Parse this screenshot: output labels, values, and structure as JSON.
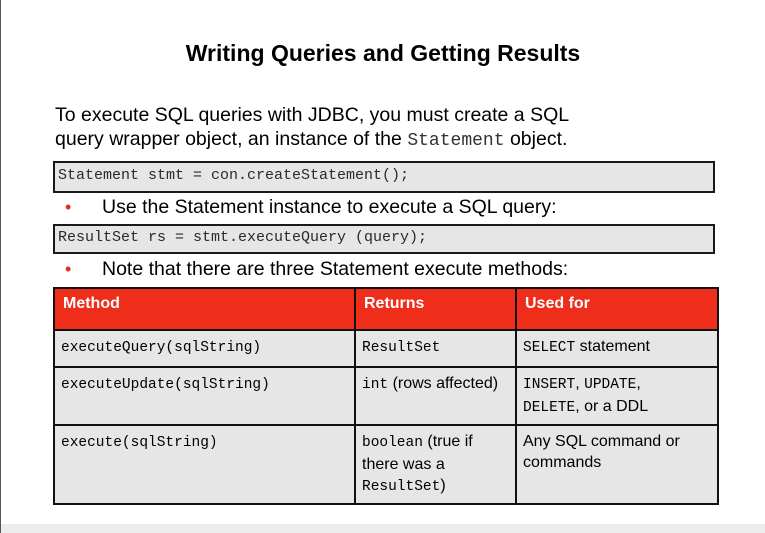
{
  "title": "Writing Queries and Getting Results",
  "intro": {
    "line1": "To execute SQL queries with JDBC, you must create a SQL",
    "line2_before": "query wrapper object, an instance of the",
    "line2_code": "Statement",
    "line2_after": "object."
  },
  "code1": "Statement stmt = con.createStatement();",
  "bullet1": "Use the Statement instance to execute a SQL query:",
  "code2": "ResultSet rs = stmt.executeQuery (query);",
  "bullet2": "Note that there are three Statement execute methods:",
  "bullet_symbol": "•",
  "table": {
    "headers": [
      "Method",
      "Returns",
      "Used for"
    ],
    "rows": [
      {
        "method": "executeQuery(sqlString)",
        "returns_code": "ResultSet",
        "returns_text": "",
        "used_code": "SELECT",
        "used_text": "statement"
      },
      {
        "method": "executeUpdate(sqlString)",
        "returns_code": "int",
        "returns_text": "(rows affected)",
        "used_code1": "INSERT",
        "used_sep1": ",",
        "used_code2": "UPDATE",
        "used_sep2": ",",
        "used_code3": "DELETE",
        "used_text": ", or a DDL"
      },
      {
        "method": "execute(sqlString)",
        "returns_code": "boolean",
        "returns_text": "(true if there was a",
        "returns_code2": "ResultSet",
        "returns_end": ")",
        "used_text": "Any SQL command or commands"
      }
    ]
  },
  "colors": {
    "header_bg": "#ee2d1a",
    "bullet": "#e0301e",
    "cell_bg": "#e6e6e6"
  }
}
